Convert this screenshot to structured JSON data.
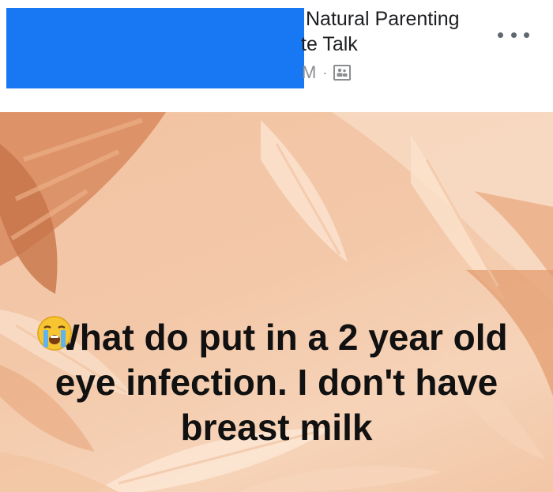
{
  "header": {
    "group_name_line1": "Natural Parenting",
    "group_name_line2": "te Talk",
    "meta_time": "M",
    "meta_separator": "·",
    "visibility_icon": "group-members-icon",
    "more_icon": "more-options-icon"
  },
  "post": {
    "text": "What do put in a 2 year old eye infection. I don't have breast milk",
    "emoji_icon": "loudly-crying-face-emoji",
    "emoji_count": 3,
    "background_colors": [
      "#f1c3a2",
      "#e79b6f",
      "#fbe4d1"
    ]
  }
}
